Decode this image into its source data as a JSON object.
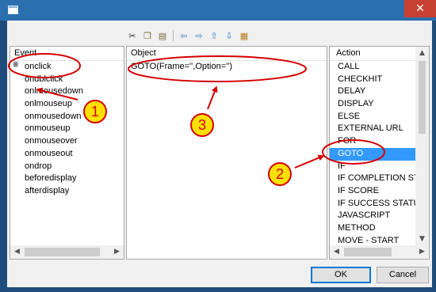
{
  "window": {
    "close_glyph": "✕",
    "icon": "window-icon"
  },
  "toolbar": {
    "buttons": [
      {
        "icon": "cut-icon",
        "glyph": "✂"
      },
      {
        "icon": "copy-icon",
        "glyph": "❐"
      },
      {
        "icon": "paste-icon",
        "glyph": "▤"
      },
      {
        "icon": "arrow-left-icon",
        "glyph": "⇦"
      },
      {
        "icon": "arrow-right-icon",
        "glyph": "⇨"
      },
      {
        "icon": "arrow-up-icon",
        "glyph": "⇧"
      },
      {
        "icon": "arrow-down-icon",
        "glyph": "⇩"
      },
      {
        "icon": "properties-icon",
        "glyph": "▦"
      }
    ]
  },
  "event_pane": {
    "header": "Event",
    "items": [
      "onclick",
      "ondblclick",
      "onlmousedown",
      "onlmouseup",
      "onmousedown",
      "onmouseup",
      "onmouseover",
      "onmouseout",
      "ondrop",
      "beforedisplay",
      "afterdisplay"
    ]
  },
  "object_pane": {
    "header": "Object",
    "value": "GOTO(Frame='',Option='')"
  },
  "action_pane": {
    "header": "Action",
    "items": [
      "CALL",
      "CHECKHIT",
      "DELAY",
      "DISPLAY",
      "ELSE",
      "EXTERNAL URL",
      "FOR",
      "GOTO",
      "IF",
      "IF COMPLETION STATUS",
      "IF SCORE",
      "IF SUCCESS STATUS",
      "JAVASCRIPT",
      "METHOD",
      "MOVE - START"
    ],
    "selected": "GOTO"
  },
  "buttons": {
    "ok": "OK",
    "cancel": "Cancel"
  },
  "annotations": {
    "one": "1",
    "two": "2",
    "three": "3"
  },
  "colors": {
    "selection": "#3399ff",
    "annotation": "#d40000",
    "badge_fill": "#ffe000",
    "titlebar": "#2a6fae",
    "close": "#c84031"
  }
}
